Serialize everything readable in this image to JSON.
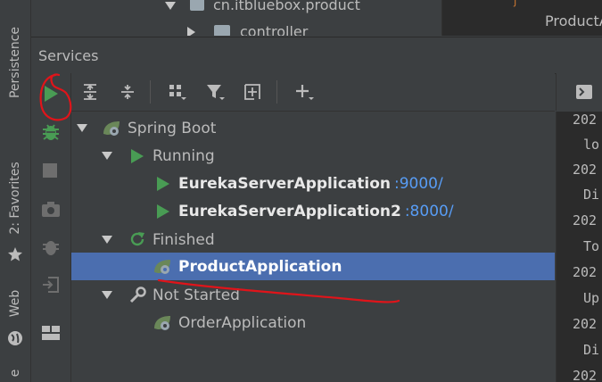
{
  "project_tree": {
    "package": "cn.itbluebox.product",
    "folder": "controller"
  },
  "editor_tab": {
    "label": "ProductA"
  },
  "side_stripe": {
    "persistence": "Persistence",
    "favorites": "2: Favorites",
    "web": "Web",
    "partial": "e"
  },
  "services": {
    "title": "Services",
    "tree": {
      "group": "Spring Boot",
      "running": {
        "label": "Running",
        "apps": [
          {
            "name": "EurekaServerApplication",
            "port": ":9000/"
          },
          {
            "name": "EurekaServerApplication2",
            "port": ":8000/"
          }
        ]
      },
      "finished": {
        "label": "Finished",
        "apps": [
          {
            "name": "ProductApplication"
          }
        ]
      },
      "not_started": {
        "label": "Not Started",
        "apps": [
          {
            "name": "OrderApplication"
          }
        ]
      }
    }
  },
  "console": {
    "lines": [
      "202",
      "lo",
      "202",
      "Di",
      "202",
      "To",
      "202",
      "Up",
      "202",
      "Di",
      "202"
    ]
  },
  "colors": {
    "run_green": "#499c54",
    "spring_green": "#6a8759",
    "selection": "#4b6eaf",
    "port_link": "#589df6",
    "annotation_red": "#e0141a"
  }
}
